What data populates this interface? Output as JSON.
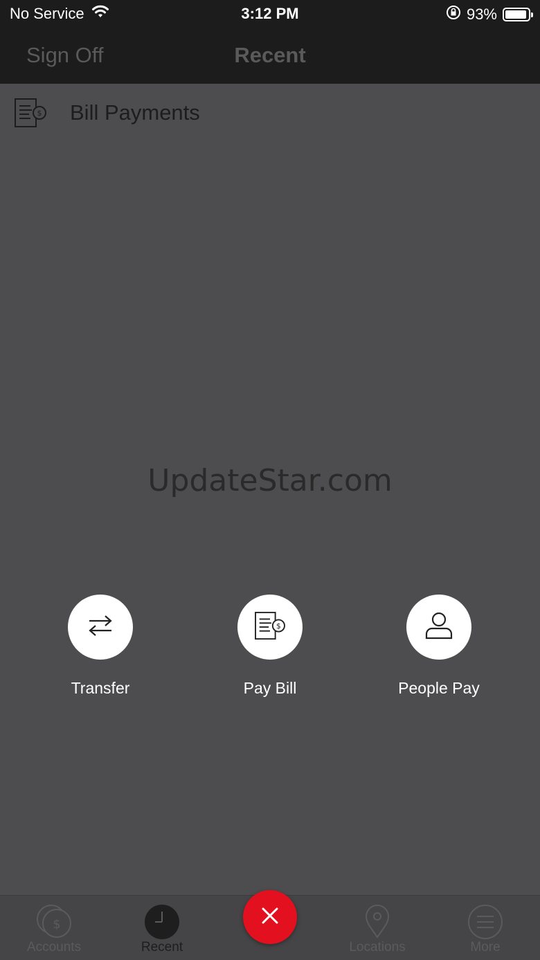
{
  "status_bar": {
    "carrier": "No Service",
    "time": "3:12 PM",
    "battery": "93%",
    "battery_level": 0.93
  },
  "header": {
    "left_action": "Sign Off",
    "title": "Recent"
  },
  "recent": {
    "items": [
      {
        "label": "Bill Payments",
        "icon": "bill-payment-icon"
      }
    ]
  },
  "watermark": "UpdateStar.com",
  "quick_actions": [
    {
      "label": "Transfer",
      "icon": "transfer-arrows-icon"
    },
    {
      "label": "Pay Bill",
      "icon": "bill-payment-icon"
    },
    {
      "label": "People Pay",
      "icon": "person-icon"
    }
  ],
  "tab_bar": {
    "tabs": [
      {
        "label": "Accounts",
        "icon": "coins-icon"
      },
      {
        "label": "Recent",
        "icon": "clock-icon",
        "active": true
      },
      {
        "label": "Locations",
        "icon": "location-pin-icon"
      },
      {
        "label": "More",
        "icon": "menu-icon"
      }
    ],
    "fab_icon": "close-icon"
  },
  "colors": {
    "background": "#4d4c4e",
    "header": "#1c1c1c",
    "fab": "#e3101f"
  }
}
